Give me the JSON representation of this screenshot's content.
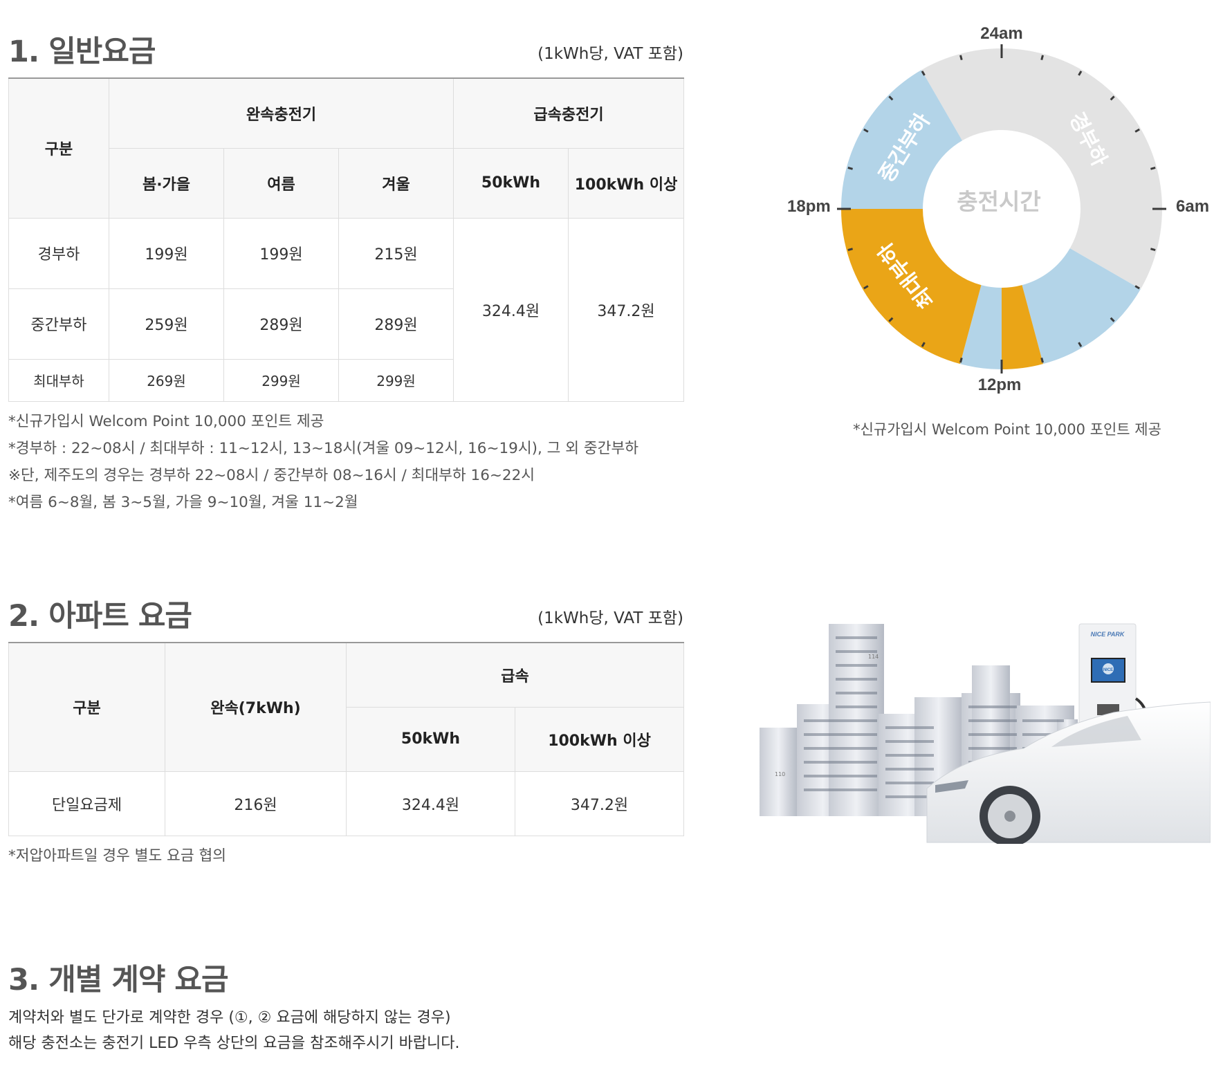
{
  "general": {
    "title": "1. 일반요금",
    "unit": "(1kWh당, VAT 포함)",
    "header": {
      "category": "구분",
      "slow": "완속충전기",
      "fast": "급속충전기",
      "spring_fall": "봄·가을",
      "summer": "여름",
      "winter": "겨울",
      "fast_50": "50kWh",
      "fast_100": "100kWh 이상"
    },
    "rows": [
      {
        "label": "경부하",
        "spring_fall": "199원",
        "summer": "199원",
        "winter": "215원"
      },
      {
        "label": "중간부하",
        "spring_fall": "259원",
        "summer": "289원",
        "winter": "289원"
      },
      {
        "label": "최대부하",
        "spring_fall": "269원",
        "summer": "299원",
        "winter": "299원"
      }
    ],
    "fast_50_price": "324.4원",
    "fast_100_price": "347.2원",
    "notes": [
      "*신규가입시 Welcom Point 10,000 포인트 제공",
      "*경부하 : 22~08시 / 최대부하 : 11~12시, 13~18시(겨울 09~12시, 16~19시), 그 외 중간부하",
      "※단, 제주도의 경우는 경부하 22~08시 / 중간부하 08~16시 / 최대부하 16~22시",
      "*여름 6~8월, 봄 3~5월, 가을 9~10월, 겨울 11~2월"
    ]
  },
  "clock": {
    "center_label": "충전시간",
    "labels": {
      "top": "24am",
      "right": "6am",
      "bottom": "12pm",
      "left": "18pm"
    },
    "segment_labels": {
      "off": "경부하",
      "mid": "중간부하",
      "peak": "최대부하"
    },
    "caption": "*신규가입시 Welcom Point 10,000 포인트 제공",
    "colors": {
      "off": "#e3e3e3",
      "mid": "#b3d4e8",
      "peak": "#eaa517"
    },
    "segments": [
      {
        "load": "off",
        "from_hour": 22,
        "to_hour": 32
      },
      {
        "load": "mid",
        "from_hour": 8,
        "to_hour": 11
      },
      {
        "load": "peak",
        "from_hour": 11,
        "to_hour": 12
      },
      {
        "load": "mid",
        "from_hour": 12,
        "to_hour": 13
      },
      {
        "load": "peak",
        "from_hour": 13,
        "to_hour": 18
      },
      {
        "load": "mid",
        "from_hour": 18,
        "to_hour": 22
      }
    ]
  },
  "apartment": {
    "title": "2. 아파트 요금",
    "unit": "(1kWh당, VAT 포함)",
    "header": {
      "category": "구분",
      "slow": "완속(7kWh)",
      "fast": "급속",
      "fast_50": "50kWh",
      "fast_100": "100kWh 이상"
    },
    "row": {
      "label": "단일요금제",
      "slow": "216원",
      "fast_50": "324.4원",
      "fast_100": "347.2원"
    },
    "note": "*저압아파트일 경우 별도 요금 협의",
    "image": {
      "charger_brand": "NICE PARK",
      "screen_text": "NICE",
      "building_number_1": "114",
      "building_number_2": "110"
    }
  },
  "individual": {
    "title": "3. 개별 계약 요금",
    "lines": [
      "계약처와 별도 단가로 계약한 경우 (①, ② 요금에 해당하지 않는 경우)",
      "해당 충전소는 충전기 LED 우측 상단의 요금을 참조해주시기 바랍니다."
    ]
  }
}
